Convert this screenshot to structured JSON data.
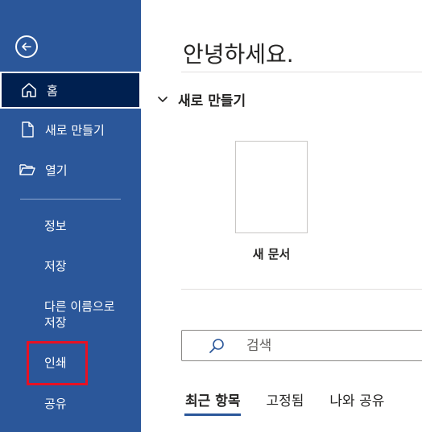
{
  "colors": {
    "sidebar": "#2b579a",
    "sidebar_selected": "#002050",
    "accent": "#2b579a",
    "highlight_border": "#e81123"
  },
  "sidebar": {
    "back_icon": "back-arrow-icon",
    "nav": [
      {
        "label": "홈",
        "icon": "home-icon"
      },
      {
        "label": "새로 만들기",
        "icon": "new-document-icon"
      },
      {
        "label": "열기",
        "icon": "folder-open-icon"
      }
    ],
    "sub": [
      "정보",
      "저장",
      "다른 이름으로\n저장",
      "인쇄",
      "공유"
    ]
  },
  "main": {
    "greeting": "안녕하세요.",
    "new_section": {
      "title": "새로 만들기",
      "toggle_icon": "chevron-down-icon",
      "blank_doc_label": "새 문서"
    },
    "search": {
      "placeholder": "검색",
      "icon": "search-icon"
    },
    "tabs": [
      {
        "label": "최근 항목",
        "active": true
      },
      {
        "label": "고정됨"
      },
      {
        "label": "나와 공유"
      }
    ]
  }
}
